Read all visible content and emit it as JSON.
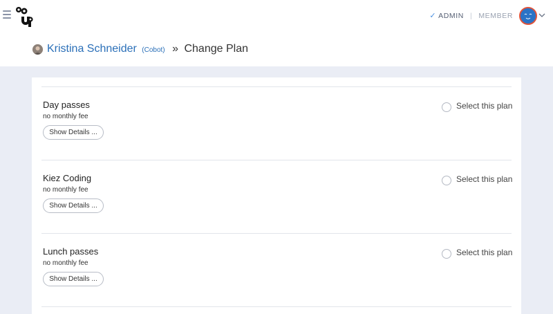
{
  "topbar": {
    "admin_label": "ADMIN",
    "member_label": "MEMBER",
    "separator": "|",
    "accent_color": "#2a73c6"
  },
  "header": {
    "user_name": "Kristina Schneider",
    "user_tag": "(Cobot)",
    "separator": "»",
    "page_title": "Change Plan"
  },
  "plans": [
    {
      "name": "Day passes",
      "fee": "no monthly fee",
      "details_label": "Show Details ...",
      "select_label": "Select this plan",
      "selected": false
    },
    {
      "name": "Kiez Coding",
      "fee": "no monthly fee",
      "details_label": "Show Details ...",
      "select_label": "Select this plan",
      "selected": false
    },
    {
      "name": "Lunch passes",
      "fee": "no monthly fee",
      "details_label": "Show Details ...",
      "select_label": "Select this plan",
      "selected": false
    }
  ]
}
